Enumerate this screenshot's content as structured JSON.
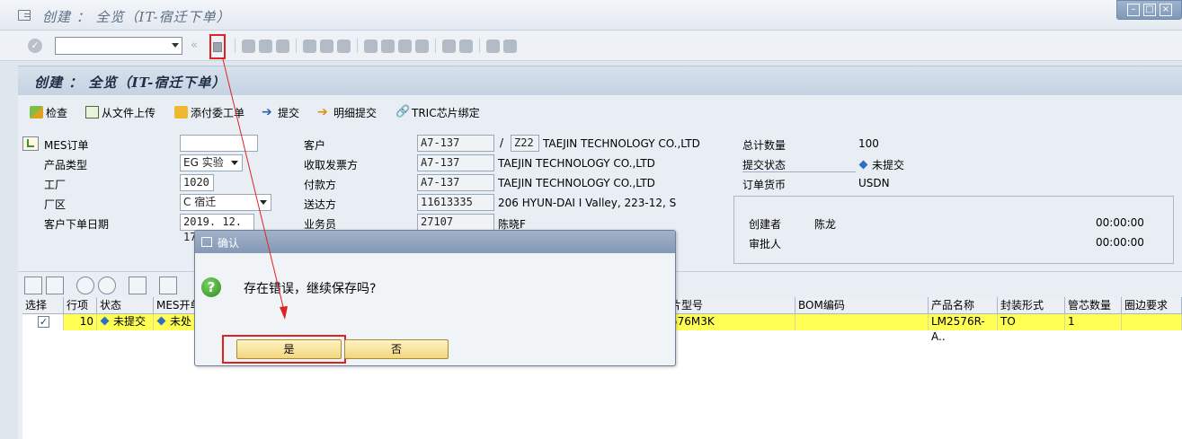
{
  "window": {
    "title": "创建 ： 全览（IT-宿迁下单）",
    "controls": [
      "–",
      "□",
      "×"
    ]
  },
  "toolbar": {
    "command_value": "",
    "double_arrow": "«"
  },
  "screen": {
    "title": "创建 ： 全览（IT-宿迁下单）"
  },
  "app_toolbar": {
    "check": "检查",
    "upload": "从文件上传",
    "add_order": "添付委工单",
    "submit": "提交",
    "detail_submit": "明细提交",
    "tric_bind": "TRIC芯片绑定"
  },
  "form": {
    "mes_order_label": "MES订单",
    "mes_order_value": "",
    "product_type_label": "产品类型",
    "product_type_value": "EG 实验",
    "plant_label": "工厂",
    "plant_value": "1020",
    "area_label": "厂区",
    "area_value": "C 宿迁",
    "order_date_label": "客户下单日期",
    "order_date_value": "2019. 12. 17",
    "customer_label": "客户",
    "customer_code": "A7-137",
    "customer_sep": "/",
    "customer_sub": "Z22",
    "customer_name": "TAEJIN TECHNOLOGY CO.,LTD",
    "invoice_label": "收取发票方",
    "invoice_code": "A7-137",
    "invoice_name": "TAEJIN TECHNOLOGY CO.,LTD",
    "payer_label": "付款方",
    "payer_code": "A7-137",
    "payer_name": "TAEJIN TECHNOLOGY CO.,LTD",
    "shipto_label": "送达方",
    "shipto_code": "11613335",
    "shipto_name": "206 HYUN-DAI I Valley, 223-12, S",
    "sales_label": "业务员",
    "sales_code": "27107",
    "sales_name": "陈晓F",
    "total_qty_label": "总计数量",
    "total_qty_value": "100",
    "submit_status_label": "提交状态",
    "submit_status_value": "未提交",
    "currency_label": "订单货币",
    "currency_value": "USDN",
    "creator_label": "创建者",
    "creator_value": "陈龙",
    "creator_time": "00:00:00",
    "approver_label": "审批人",
    "approver_time": "00:00:00"
  },
  "table": {
    "columns": [
      "选择",
      "行项",
      "状态",
      "MES开单",
      "片型号",
      "BOM编码",
      "产品名称",
      "封装形式",
      "管芯数量",
      "圈边要求"
    ],
    "rows": [
      {
        "select": "✓",
        "item": "10",
        "status": "未提交",
        "mes": "未处",
        "chip": "576M3K",
        "bom": "",
        "product": "LM2576R-A..",
        "package": "TO",
        "die_qty": "1",
        "edge": ""
      }
    ]
  },
  "dialog": {
    "title": "确认",
    "message": "存在错误，继续保存吗?",
    "yes": "是",
    "no": "否"
  },
  "colors": {
    "highlight_row": "#ffff55",
    "annotation_red": "#dd2222",
    "status_diamond": "#2f6fc2"
  }
}
